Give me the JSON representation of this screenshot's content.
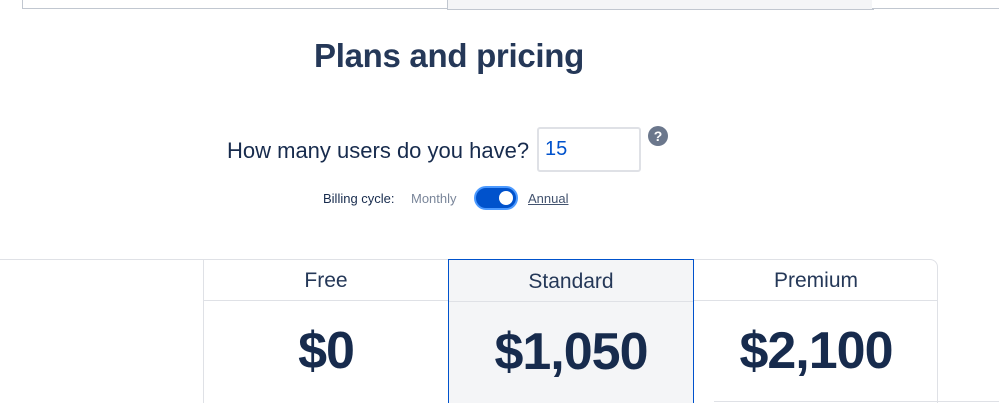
{
  "page_title": "Plans and pricing",
  "users": {
    "question": "How many users do you have?",
    "value": "15",
    "help_icon": "?"
  },
  "billing": {
    "label": "Billing cycle:",
    "monthly": "Monthly",
    "annual": "Annual",
    "selected": "Annual"
  },
  "plans": [
    {
      "name": "Free",
      "price": "$0"
    },
    {
      "name": "Standard",
      "price": "$1,050"
    },
    {
      "name": "Premium",
      "price": "$2,100"
    }
  ],
  "colors": {
    "accent": "#0052cc",
    "title": "#253858"
  }
}
